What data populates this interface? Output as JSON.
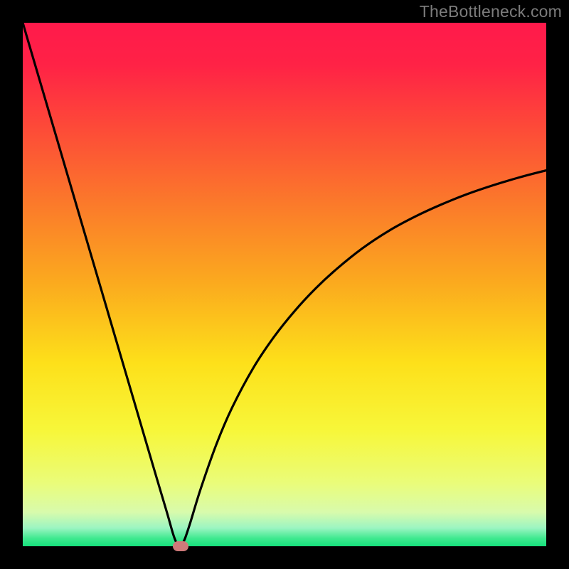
{
  "watermark": "TheBottleneck.com",
  "chart_data": {
    "type": "line",
    "title": "",
    "xlabel": "",
    "ylabel": "",
    "xlim": [
      0,
      100
    ],
    "ylim": [
      0,
      100
    ],
    "grid": false,
    "legend": false,
    "background_gradient": {
      "stops": [
        {
          "pos": 0.0,
          "color": "#ff1a4b"
        },
        {
          "pos": 0.08,
          "color": "#ff2246"
        },
        {
          "pos": 0.2,
          "color": "#fd4a38"
        },
        {
          "pos": 0.35,
          "color": "#fb7b2a"
        },
        {
          "pos": 0.5,
          "color": "#fbab1e"
        },
        {
          "pos": 0.65,
          "color": "#fde01a"
        },
        {
          "pos": 0.78,
          "color": "#f7f73a"
        },
        {
          "pos": 0.88,
          "color": "#eafc7a"
        },
        {
          "pos": 0.935,
          "color": "#d8fbac"
        },
        {
          "pos": 0.965,
          "color": "#9cf5c2"
        },
        {
          "pos": 0.985,
          "color": "#3fe98f"
        },
        {
          "pos": 1.0,
          "color": "#16e07c"
        }
      ]
    },
    "series": [
      {
        "name": "bottleneck-curve",
        "color": "#000000",
        "x": [
          0.0,
          2.5,
          5.0,
          7.5,
          10.0,
          12.5,
          15.0,
          17.5,
          20.0,
          22.5,
          25.0,
          27.5,
          28.7,
          29.3,
          29.8,
          30.1,
          30.4,
          31.0,
          32.0,
          34.0,
          37.0,
          40.0,
          44.0,
          48.0,
          52.0,
          56.0,
          60.0,
          65.0,
          70.0,
          75.0,
          80.0,
          85.0,
          90.0,
          95.0,
          100.0
        ],
        "y": [
          100.0,
          91.5,
          83.0,
          74.5,
          66.0,
          57.5,
          49.0,
          40.5,
          32.0,
          23.5,
          15.0,
          6.6,
          2.4,
          0.8,
          0.2,
          0.0,
          0.3,
          1.5,
          4.5,
          11.0,
          19.5,
          26.5,
          34.0,
          40.0,
          45.0,
          49.3,
          53.0,
          57.0,
          60.3,
          63.0,
          65.3,
          67.3,
          69.0,
          70.5,
          71.8
        ]
      }
    ],
    "marker": {
      "x": 30.1,
      "y": 0.0,
      "color": "#cf7a7a"
    }
  }
}
